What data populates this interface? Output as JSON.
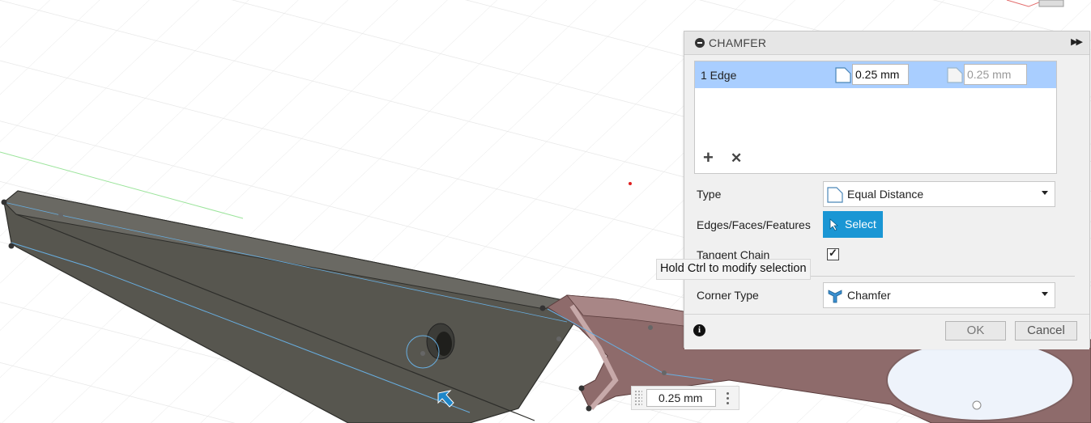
{
  "panel": {
    "title": "CHAMFER",
    "edge_row": {
      "label": "1 Edge",
      "distance_1": "0.25 mm",
      "distance_2": "0.25 mm"
    },
    "type": {
      "label": "Type",
      "value": "Equal Distance"
    },
    "edges": {
      "label": "Edges/Faces/Features",
      "button": "Select"
    },
    "tangent_chain": {
      "label": "Tangent Chain",
      "checked": true
    },
    "corner_type": {
      "label": "Corner Type",
      "value": "Chamfer"
    },
    "ok": "OK",
    "cancel": "Cancel"
  },
  "tooltip": "Hold Ctrl to modify selection",
  "dimension_input": "0.25 mm",
  "colors": {
    "selection_row": "#a9ceff",
    "select_button": "#1a96d4",
    "body_dark": "#5e5d59",
    "body_selected": "#8a6a6a"
  },
  "icons": [
    "collapse-icon",
    "expand-icon",
    "chamfer-distance-icon",
    "add-icon",
    "remove-icon",
    "cursor-icon",
    "corner-chamfer-icon",
    "info-icon",
    "kebab-menu-icon"
  ]
}
